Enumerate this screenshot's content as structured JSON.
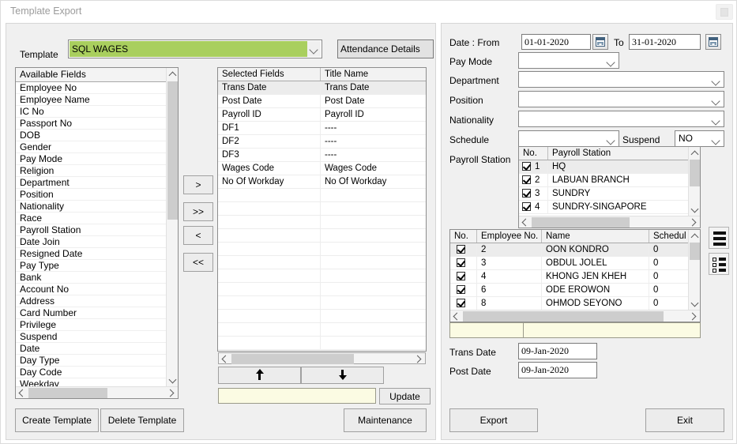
{
  "window": {
    "title": "Template Export",
    "corner_icon": "restore-icon"
  },
  "left_panel": {
    "template_label": "Template",
    "template_value": "SQL WAGES",
    "template_accent_color": "#a9cf5e",
    "template_title_value": "Attendance Details",
    "available_fields": {
      "header": "Available Fields",
      "items": [
        "Employee No",
        "Employee Name",
        "IC No",
        "Passport No",
        "DOB",
        "Gender",
        "Pay Mode",
        "Religion",
        "Department",
        "Position",
        "Nationality",
        "Race",
        "Payroll Station",
        "Date Join",
        "Resigned Date",
        "Pay Type",
        "Bank",
        "Account No",
        "Address",
        "Card Number",
        "Privilege",
        "Suspend",
        "Date",
        "Day Type",
        "Day Code",
        "Weekday"
      ]
    },
    "transfer_buttons": [
      {
        "name": "move-right",
        "label": ">"
      },
      {
        "name": "move-all-right",
        "label": ">>"
      },
      {
        "name": "move-left",
        "label": "<"
      },
      {
        "name": "move-all-left",
        "label": "<<"
      }
    ],
    "selected_fields": {
      "headers": [
        "Selected Fields",
        "Title Name"
      ],
      "rows": [
        {
          "field": "Trans Date",
          "title": "Trans Date",
          "selected": true
        },
        {
          "field": "Post Date",
          "title": "Post Date",
          "selected": false
        },
        {
          "field": "Payroll ID",
          "title": "Payroll ID",
          "selected": false
        },
        {
          "field": "DF1",
          "title": "----",
          "selected": false
        },
        {
          "field": "DF2",
          "title": "----",
          "selected": false
        },
        {
          "field": "DF3",
          "title": "----",
          "selected": false
        },
        {
          "field": "Wages Code",
          "title": "Wages Code",
          "selected": false
        },
        {
          "field": "No Of Workday",
          "title": "No Of Workday",
          "selected": false
        }
      ]
    },
    "order_buttons": [
      {
        "name": "move-up",
        "icon": "arrow-up-icon"
      },
      {
        "name": "move-down",
        "icon": "arrow-down-icon"
      }
    ],
    "title_edit_value": "",
    "update_label": "Update",
    "create_template_label": "Create Template",
    "delete_template_label": "Delete Template",
    "maintenance_label": "Maintenance"
  },
  "right_panel": {
    "date_from_label": "Date : From",
    "date_from_value": "01-01-2020",
    "date_to_label": "To",
    "date_to_value": "31-01-2020",
    "pay_mode_label": "Pay Mode",
    "pay_mode_value": "",
    "department_label": "Department",
    "department_value": "",
    "position_label": "Position",
    "position_value": "",
    "nationality_label": "Nationality",
    "nationality_value": "",
    "schedule_label": "Schedule",
    "schedule_value": "",
    "suspend_label": "Suspend",
    "suspend_value": "NO",
    "payroll_station_label": "Payroll Station",
    "payroll_station_grid": {
      "headers": [
        "No.",
        "Payroll Station"
      ],
      "rows": [
        {
          "no": "1",
          "station": "HQ",
          "checked": true,
          "selected": true
        },
        {
          "no": "2",
          "station": "LABUAN BRANCH",
          "checked": true,
          "selected": false
        },
        {
          "no": "3",
          "station": "SUNDRY",
          "checked": true,
          "selected": false
        },
        {
          "no": "4",
          "station": "SUNDRY-SINGAPORE",
          "checked": true,
          "selected": false
        }
      ]
    },
    "employee_grid": {
      "headers": [
        "No.",
        "Employee No.",
        "Name",
        "Schedul"
      ],
      "rows": [
        {
          "no": "2",
          "employee_no": "",
          "name": "OON KONDRO",
          "schedule": "0",
          "checked": true,
          "selected": true
        },
        {
          "no": "3",
          "employee_no": "",
          "name": "OBDUL JOLEL",
          "schedule": "0",
          "checked": true,
          "selected": false
        },
        {
          "no": "4",
          "employee_no": "",
          "name": "KHONG JEN KHEH",
          "schedule": "0",
          "checked": true,
          "selected": false
        },
        {
          "no": "6",
          "employee_no": "",
          "name": "ODE EROWON",
          "schedule": "0",
          "checked": true,
          "selected": false
        },
        {
          "no": "8",
          "employee_no": "",
          "name": "OHMOD SEYONO",
          "schedule": "0",
          "checked": true,
          "selected": false
        }
      ],
      "footer_left": "",
      "footer_right": ""
    },
    "side_buttons": [
      {
        "name": "select-all-icon"
      },
      {
        "name": "deselect-all-icon"
      }
    ],
    "trans_date_label": "Trans Date",
    "trans_date_value": "09-Jan-2020",
    "post_date_label": "Post Date",
    "post_date_value": "09-Jan-2020",
    "export_label": "Export",
    "exit_label": "Exit"
  }
}
